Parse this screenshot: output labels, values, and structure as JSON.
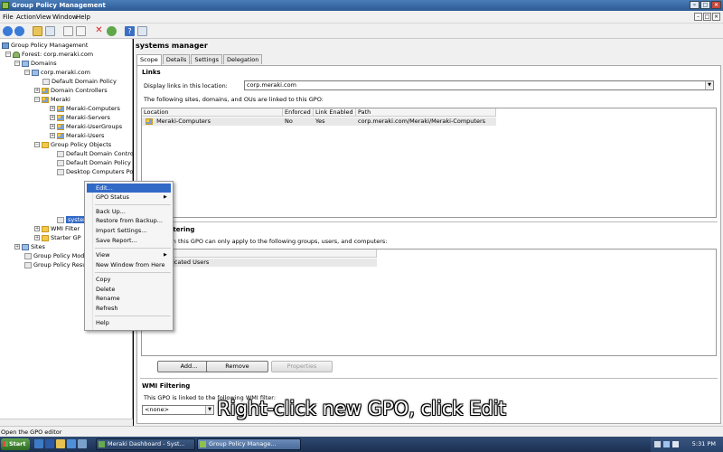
{
  "window": {
    "title": "Group Policy Management"
  },
  "menubar": {
    "items": [
      "File",
      "Action",
      "View",
      "Window",
      "Help"
    ]
  },
  "tree": {
    "nodes": [
      {
        "label": "Group Policy Management"
      },
      {
        "label": "Forest: corp.meraki.com"
      },
      {
        "label": "Domains"
      },
      {
        "label": "corp.meraki.com"
      },
      {
        "label": "Default Domain Policy"
      },
      {
        "label": "Domain Controllers"
      },
      {
        "label": "Meraki"
      },
      {
        "label": "Meraki-Computers"
      },
      {
        "label": "Meraki-Servers"
      },
      {
        "label": "Meraki-UserGroups"
      },
      {
        "label": "Meraki-Users"
      },
      {
        "label": "Group Policy Objects"
      },
      {
        "label": "Default Domain Contro"
      },
      {
        "label": "Default Domain Policy"
      },
      {
        "label": "Desktop Computers Po"
      },
      {
        "label": "systems manager"
      },
      {
        "label": "WMI Filter"
      },
      {
        "label": "Starter GP"
      },
      {
        "label": "Sites"
      },
      {
        "label": "Group Policy Mode"
      },
      {
        "label": "Group Policy Resul"
      }
    ]
  },
  "details": {
    "title": "systems manager",
    "tabs": [
      "Scope",
      "Details",
      "Settings",
      "Delegation"
    ],
    "links": {
      "heading": "Links",
      "location_label": "Display links in this location:",
      "location_value": "corp.meraki.com",
      "description": "The following sites, domains, and OUs are linked to this GPO:",
      "columns": [
        "Location",
        "Enforced",
        "Link Enabled",
        "Path"
      ],
      "rows": [
        {
          "location": "Meraki-Computers",
          "enforced": "No",
          "link_enabled": "Yes",
          "path": "corp.meraki.com/Meraki/Meraki-Computers"
        }
      ]
    },
    "security": {
      "heading": "ltering",
      "description": "in this GPO can only apply to the following groups, users, and computers:",
      "rows": [
        "icated Users"
      ],
      "buttons": {
        "add": "Add...",
        "remove": "Remove",
        "properties": "Properties"
      }
    },
    "wmi": {
      "heading": "WMI Filtering",
      "description": "This GPO is linked to the following WMI filter:",
      "value": "<none>"
    }
  },
  "context_menu": {
    "items": [
      {
        "label": "Edit..."
      },
      {
        "label": "GPO Status"
      },
      {
        "label": "Back Up..."
      },
      {
        "label": "Restore from Backup..."
      },
      {
        "label": "Import Settings..."
      },
      {
        "label": "Save Report..."
      },
      {
        "label": "View"
      },
      {
        "label": "New Window from Here"
      },
      {
        "label": "Copy"
      },
      {
        "label": "Delete"
      },
      {
        "label": "Rename"
      },
      {
        "label": "Refresh"
      },
      {
        "label": "Help"
      }
    ]
  },
  "statusbar": {
    "text": "Open the GPO editor"
  },
  "taskbar": {
    "start": "Start",
    "tasks": [
      "Meraki Dashboard - Syst...",
      "Group Policy Manage..."
    ],
    "clock": "5:31 PM"
  },
  "caption": "Right-click new GPO, click Edit",
  "colors": {
    "selection": "#3169c6",
    "titlebar": "#2b5a95",
    "taskbar": "#1b3052"
  }
}
